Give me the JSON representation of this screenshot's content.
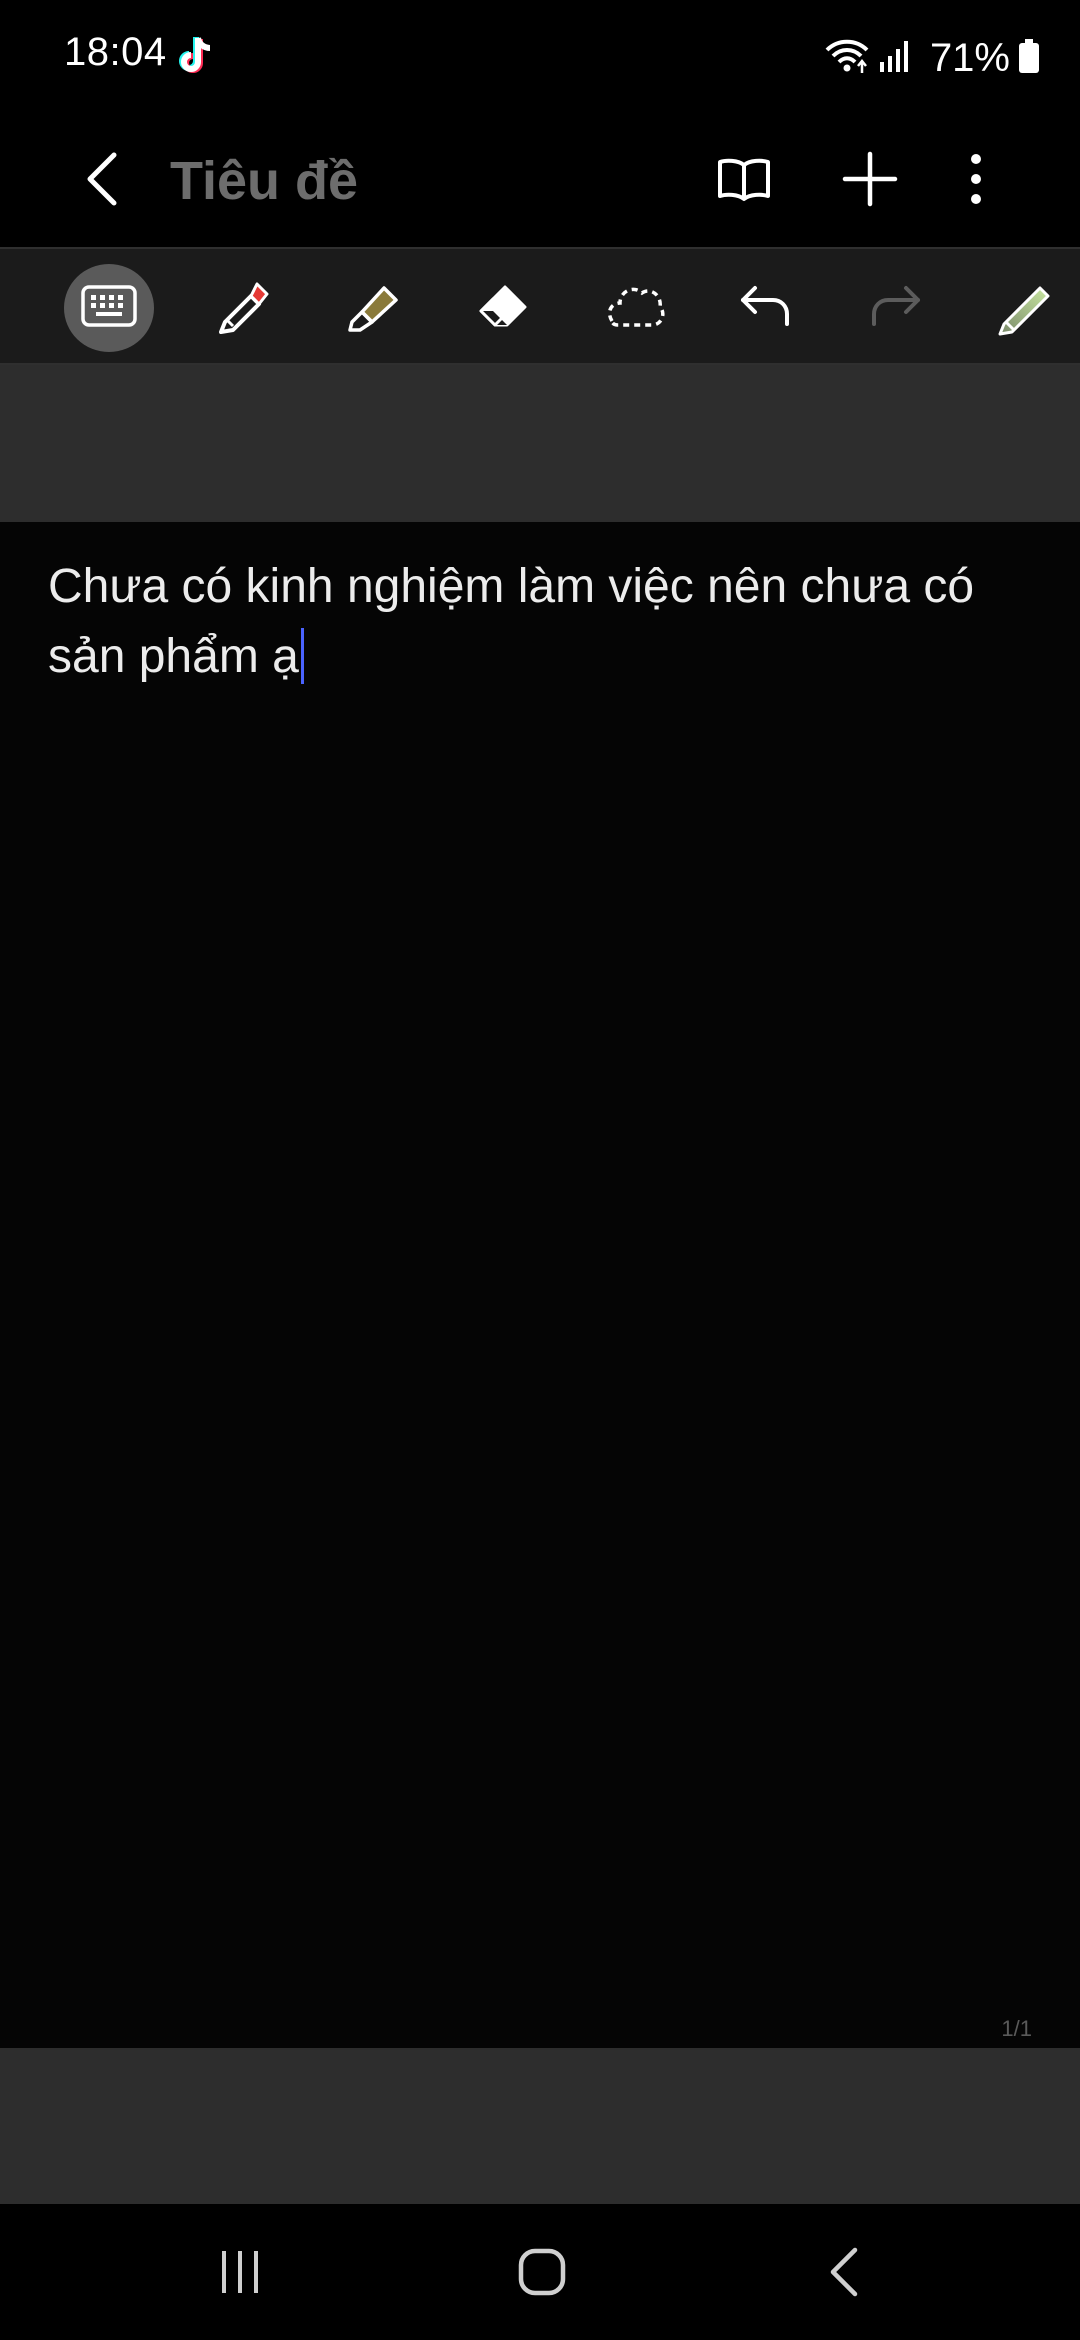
{
  "status_bar": {
    "time": "18:04",
    "battery": "71%",
    "icons": [
      "tiktok-icon",
      "wifi-icon",
      "signal-icon",
      "battery-icon"
    ]
  },
  "app_bar": {
    "title": "Tiêu đề",
    "icons": [
      "back-arrow-icon",
      "book-icon",
      "plus-icon",
      "more-vertical-icon"
    ]
  },
  "toolbar": {
    "tools": [
      {
        "name": "keyboard",
        "icon": "keyboard-icon",
        "active": true
      },
      {
        "name": "pen",
        "icon": "pen-icon",
        "color": "#e53935"
      },
      {
        "name": "highlighter",
        "icon": "highlighter-icon",
        "color": "#8a7a3a"
      },
      {
        "name": "eraser",
        "icon": "eraser-icon"
      },
      {
        "name": "lasso",
        "icon": "lasso-icon"
      },
      {
        "name": "undo",
        "icon": "undo-icon"
      },
      {
        "name": "redo",
        "icon": "redo-icon",
        "disabled": true
      },
      {
        "name": "pen-settings",
        "icon": "pencil-icon"
      }
    ]
  },
  "note": {
    "body": "Chưa có kinh nghiệm làm việc nên chưa có sản phẩm ạ",
    "page_indicator": "1/1"
  },
  "nav_bar": {
    "icons": [
      "recents-icon",
      "home-icon",
      "back-icon"
    ]
  },
  "colors": {
    "background": "#000000",
    "toolbar": "#1b1b1b",
    "band": "#2d2d2d",
    "caret": "#4a63ff",
    "title": "#6d6d6d"
  }
}
